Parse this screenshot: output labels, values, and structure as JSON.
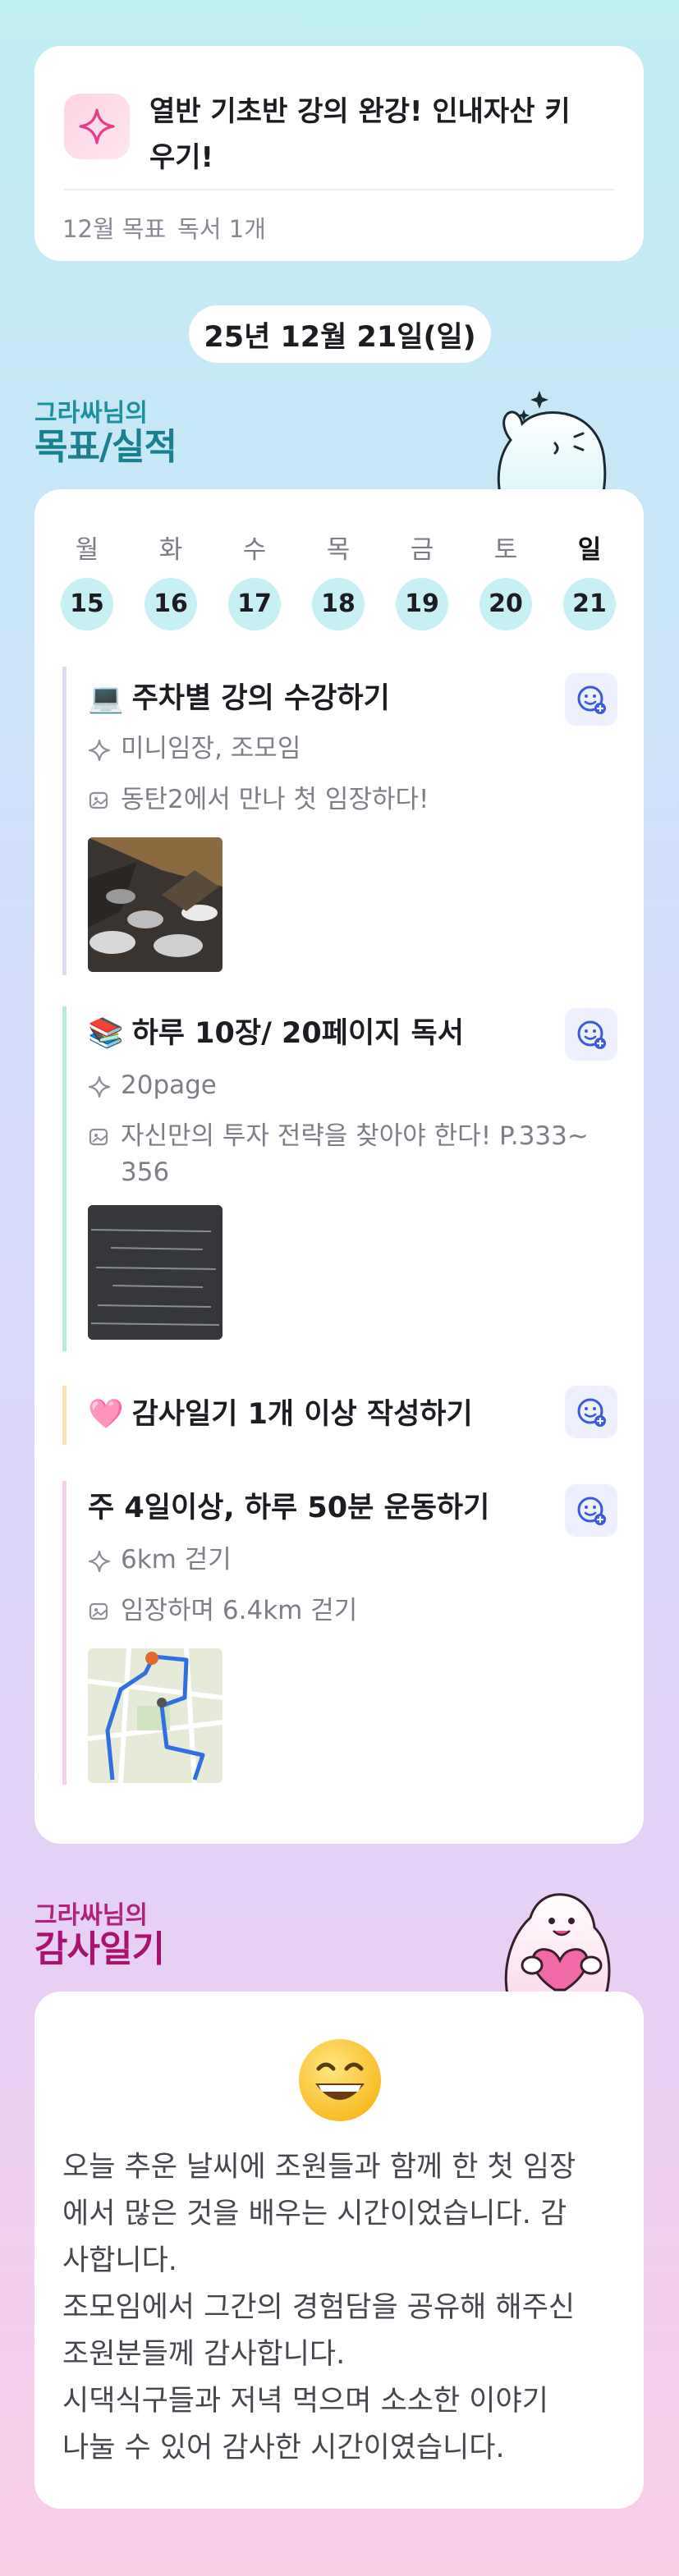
{
  "goal_card": {
    "icon": "sparkle-icon",
    "title_line1": "열반 기초반 강의 완강! 인내자산 키",
    "title_line2": "우기!",
    "monthly_label": "12월 목표",
    "monthly_value": "독서 1개"
  },
  "date": "25년 12월 21일(일)",
  "goals_section": {
    "subtitle": "그라싸님의",
    "title": "목표/실적"
  },
  "week": [
    {
      "day": "월",
      "num": "15"
    },
    {
      "day": "화",
      "num": "16"
    },
    {
      "day": "수",
      "num": "17"
    },
    {
      "day": "목",
      "num": "18"
    },
    {
      "day": "금",
      "num": "19"
    },
    {
      "day": "토",
      "num": "20"
    },
    {
      "day": "일",
      "num": "21"
    }
  ],
  "goals": [
    {
      "emoji": "💻",
      "title": "주차별 강의 수강하기",
      "result": "미니임장, 조모임",
      "memo": "동탄2에서 만나 첫 임장하다!"
    },
    {
      "emoji": "📚",
      "title": "하루 10장/ 20페이지 독서",
      "result": "20page",
      "memo_line1": "자신만의 투자 전략을 찾아야 한다! P.333~",
      "memo_line2": "356"
    },
    {
      "emoji": "🩷",
      "title": "감사일기 1개 이상 작성하기"
    },
    {
      "title": "주 4일이상, 하루 50분 운동하기",
      "result": "6km 걷기",
      "memo": "임장하며 6.4km 걷기"
    }
  ],
  "diary_section": {
    "subtitle": "그라싸님의",
    "title": "감사일기"
  },
  "diary": {
    "emoji": "😄",
    "lines": [
      "오늘 추운 날씨에 조원들과 함께 한 첫 임장",
      "에서 많은 것을 배우는 시간이었습니다. 감",
      "사합니다.",
      "조모임에서 그간의 경험담을 공유해 해주신",
      "조원분들께 감사합니다.",
      "시댁식구들과 저녁 먹으며 소소한 이야기",
      "나눌 수 있어 감사한 시간이였습니다."
    ]
  },
  "colors": {
    "accent_teal": "#1a7f90",
    "accent_magenta": "#a8136f",
    "day_circle": "#c7f0f5",
    "react_btn": "#3b5bdb"
  }
}
